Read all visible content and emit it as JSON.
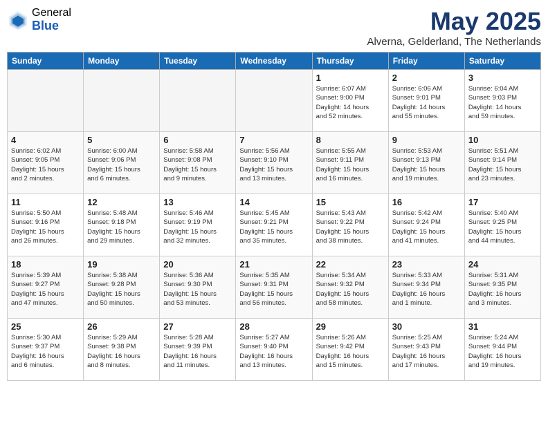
{
  "logo": {
    "general": "General",
    "blue": "Blue"
  },
  "title": "May 2025",
  "location": "Alverna, Gelderland, The Netherlands",
  "headers": [
    "Sunday",
    "Monday",
    "Tuesday",
    "Wednesday",
    "Thursday",
    "Friday",
    "Saturday"
  ],
  "weeks": [
    [
      {
        "day": "",
        "info": ""
      },
      {
        "day": "",
        "info": ""
      },
      {
        "day": "",
        "info": ""
      },
      {
        "day": "",
        "info": ""
      },
      {
        "day": "1",
        "info": "Sunrise: 6:07 AM\nSunset: 9:00 PM\nDaylight: 14 hours\nand 52 minutes."
      },
      {
        "day": "2",
        "info": "Sunrise: 6:06 AM\nSunset: 9:01 PM\nDaylight: 14 hours\nand 55 minutes."
      },
      {
        "day": "3",
        "info": "Sunrise: 6:04 AM\nSunset: 9:03 PM\nDaylight: 14 hours\nand 59 minutes."
      }
    ],
    [
      {
        "day": "4",
        "info": "Sunrise: 6:02 AM\nSunset: 9:05 PM\nDaylight: 15 hours\nand 2 minutes."
      },
      {
        "day": "5",
        "info": "Sunrise: 6:00 AM\nSunset: 9:06 PM\nDaylight: 15 hours\nand 6 minutes."
      },
      {
        "day": "6",
        "info": "Sunrise: 5:58 AM\nSunset: 9:08 PM\nDaylight: 15 hours\nand 9 minutes."
      },
      {
        "day": "7",
        "info": "Sunrise: 5:56 AM\nSunset: 9:10 PM\nDaylight: 15 hours\nand 13 minutes."
      },
      {
        "day": "8",
        "info": "Sunrise: 5:55 AM\nSunset: 9:11 PM\nDaylight: 15 hours\nand 16 minutes."
      },
      {
        "day": "9",
        "info": "Sunrise: 5:53 AM\nSunset: 9:13 PM\nDaylight: 15 hours\nand 19 minutes."
      },
      {
        "day": "10",
        "info": "Sunrise: 5:51 AM\nSunset: 9:14 PM\nDaylight: 15 hours\nand 23 minutes."
      }
    ],
    [
      {
        "day": "11",
        "info": "Sunrise: 5:50 AM\nSunset: 9:16 PM\nDaylight: 15 hours\nand 26 minutes."
      },
      {
        "day": "12",
        "info": "Sunrise: 5:48 AM\nSunset: 9:18 PM\nDaylight: 15 hours\nand 29 minutes."
      },
      {
        "day": "13",
        "info": "Sunrise: 5:46 AM\nSunset: 9:19 PM\nDaylight: 15 hours\nand 32 minutes."
      },
      {
        "day": "14",
        "info": "Sunrise: 5:45 AM\nSunset: 9:21 PM\nDaylight: 15 hours\nand 35 minutes."
      },
      {
        "day": "15",
        "info": "Sunrise: 5:43 AM\nSunset: 9:22 PM\nDaylight: 15 hours\nand 38 minutes."
      },
      {
        "day": "16",
        "info": "Sunrise: 5:42 AM\nSunset: 9:24 PM\nDaylight: 15 hours\nand 41 minutes."
      },
      {
        "day": "17",
        "info": "Sunrise: 5:40 AM\nSunset: 9:25 PM\nDaylight: 15 hours\nand 44 minutes."
      }
    ],
    [
      {
        "day": "18",
        "info": "Sunrise: 5:39 AM\nSunset: 9:27 PM\nDaylight: 15 hours\nand 47 minutes."
      },
      {
        "day": "19",
        "info": "Sunrise: 5:38 AM\nSunset: 9:28 PM\nDaylight: 15 hours\nand 50 minutes."
      },
      {
        "day": "20",
        "info": "Sunrise: 5:36 AM\nSunset: 9:30 PM\nDaylight: 15 hours\nand 53 minutes."
      },
      {
        "day": "21",
        "info": "Sunrise: 5:35 AM\nSunset: 9:31 PM\nDaylight: 15 hours\nand 56 minutes."
      },
      {
        "day": "22",
        "info": "Sunrise: 5:34 AM\nSunset: 9:32 PM\nDaylight: 15 hours\nand 58 minutes."
      },
      {
        "day": "23",
        "info": "Sunrise: 5:33 AM\nSunset: 9:34 PM\nDaylight: 16 hours\nand 1 minute."
      },
      {
        "day": "24",
        "info": "Sunrise: 5:31 AM\nSunset: 9:35 PM\nDaylight: 16 hours\nand 3 minutes."
      }
    ],
    [
      {
        "day": "25",
        "info": "Sunrise: 5:30 AM\nSunset: 9:37 PM\nDaylight: 16 hours\nand 6 minutes."
      },
      {
        "day": "26",
        "info": "Sunrise: 5:29 AM\nSunset: 9:38 PM\nDaylight: 16 hours\nand 8 minutes."
      },
      {
        "day": "27",
        "info": "Sunrise: 5:28 AM\nSunset: 9:39 PM\nDaylight: 16 hours\nand 11 minutes."
      },
      {
        "day": "28",
        "info": "Sunrise: 5:27 AM\nSunset: 9:40 PM\nDaylight: 16 hours\nand 13 minutes."
      },
      {
        "day": "29",
        "info": "Sunrise: 5:26 AM\nSunset: 9:42 PM\nDaylight: 16 hours\nand 15 minutes."
      },
      {
        "day": "30",
        "info": "Sunrise: 5:25 AM\nSunset: 9:43 PM\nDaylight: 16 hours\nand 17 minutes."
      },
      {
        "day": "31",
        "info": "Sunrise: 5:24 AM\nSunset: 9:44 PM\nDaylight: 16 hours\nand 19 minutes."
      }
    ]
  ]
}
